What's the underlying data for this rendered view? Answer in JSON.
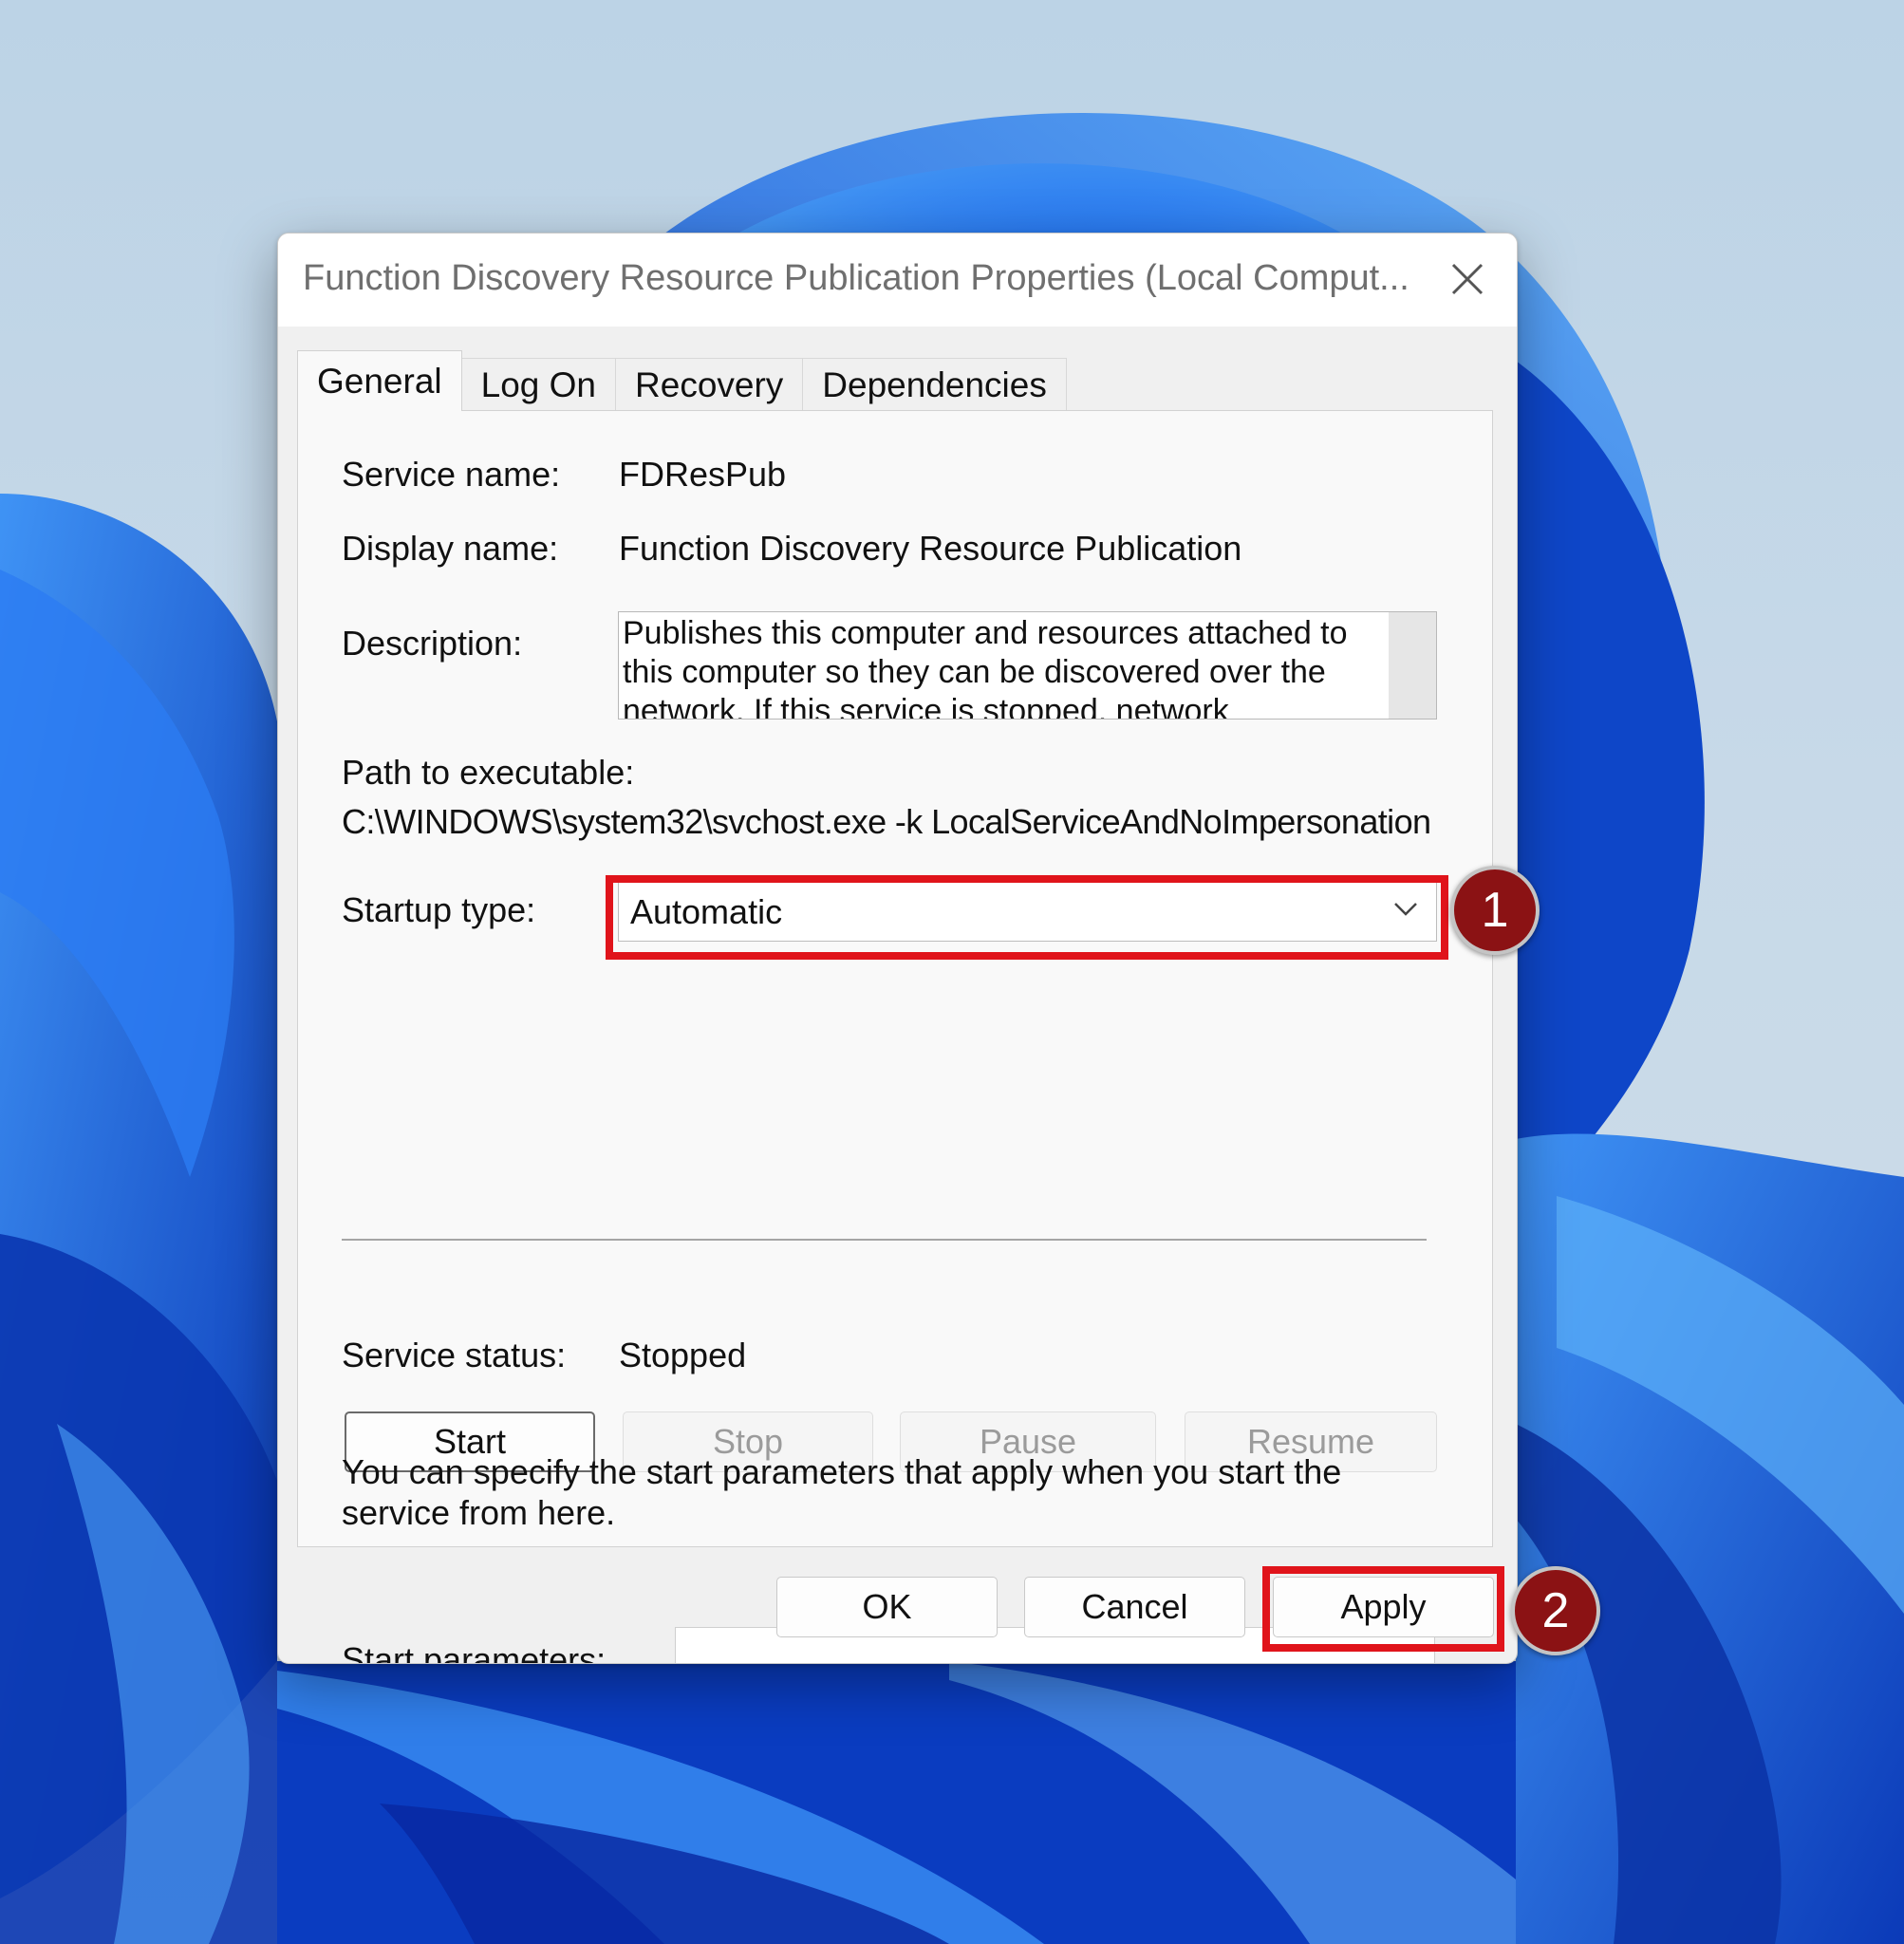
{
  "dialog": {
    "title": "Function Discovery Resource Publication Properties (Local Comput...",
    "tabs": [
      {
        "label": "General"
      },
      {
        "label": "Log On"
      },
      {
        "label": "Recovery"
      },
      {
        "label": "Dependencies"
      }
    ],
    "active_tab": "General"
  },
  "general": {
    "service_name_label": "Service name:",
    "service_name": "FDResPub",
    "display_name_label": "Display name:",
    "display_name": "Function Discovery Resource Publication",
    "description_label": "Description:",
    "description": "Publishes this computer and resources attached to this computer so they can be discovered over the network.  If this service is stopped, network",
    "path_label": "Path to executable:",
    "path": "C:\\WINDOWS\\system32\\svchost.exe -k LocalServiceAndNoImpersonation",
    "startup_type_label": "Startup type:",
    "startup_type": "Automatic",
    "service_status_label": "Service status:",
    "service_status": "Stopped",
    "buttons": {
      "start": "Start",
      "stop": "Stop",
      "pause": "Pause",
      "resume": "Resume"
    },
    "start_params_note": "You can specify the start parameters that apply when you start the service from here.",
    "start_params_label": "Start parameters:",
    "start_params_value": ""
  },
  "footer": {
    "ok": "OK",
    "cancel": "Cancel",
    "apply": "Apply"
  },
  "annotations": {
    "marker_1": "1",
    "marker_2": "2",
    "highlight_color": "#e0141b",
    "marker_color": "#8b1214"
  },
  "icons": {
    "close": "close-icon",
    "dropdown": "chevron-down-icon"
  }
}
